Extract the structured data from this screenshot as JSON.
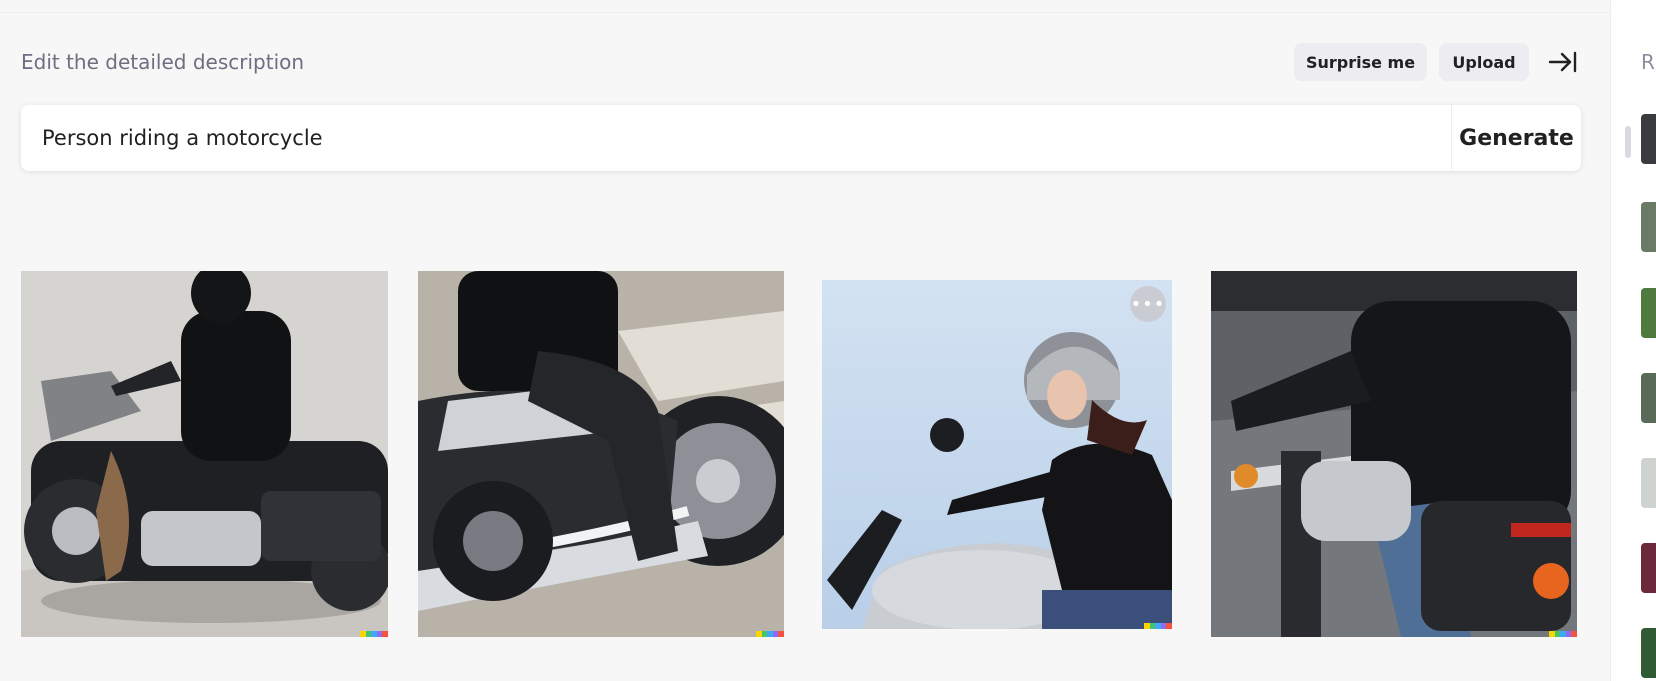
{
  "editor": {
    "caption": "Edit the detailed description",
    "surprise_label": "Surprise me",
    "upload_label": "Upload",
    "prompt_value": "Person riding a motorcycle",
    "generate_label": "Generate"
  },
  "results": [
    {
      "alt": "Person riding a motorcycle"
    },
    {
      "alt": "Person riding a motorcycle"
    },
    {
      "alt": "Person riding a motorcycle"
    },
    {
      "alt": "Person riding a motorcycle"
    }
  ],
  "history_panel": {
    "label": "R"
  },
  "colors": {
    "background": "#f7f7f8",
    "signature": [
      "#f9d600",
      "#44c46b",
      "#3fa9f5",
      "#8a6cf7",
      "#f5523f"
    ]
  },
  "icons": {
    "collapse": "collapse-panel-icon",
    "more": "more-options-icon"
  }
}
